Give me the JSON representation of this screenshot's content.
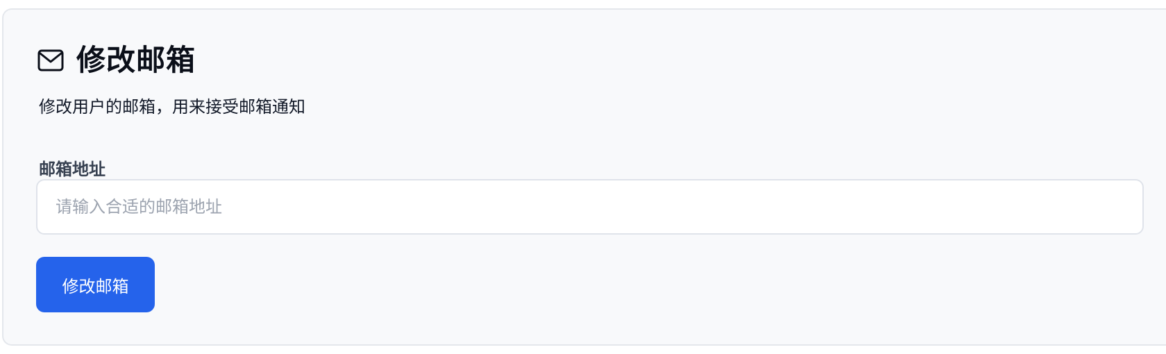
{
  "header": {
    "icon": "mail-icon",
    "title": "修改邮箱",
    "subtitle": "修改用户的邮箱，用来接受邮箱通知"
  },
  "form": {
    "email_label": "邮箱地址",
    "email_value": "",
    "email_placeholder": "请输入合适的邮箱地址",
    "submit_label": "修改邮箱"
  },
  "colors": {
    "primary": "#2563eb",
    "card_background": "#f8f9fb",
    "title_text": "#0b0f19",
    "placeholder_text": "#9ca3af"
  }
}
